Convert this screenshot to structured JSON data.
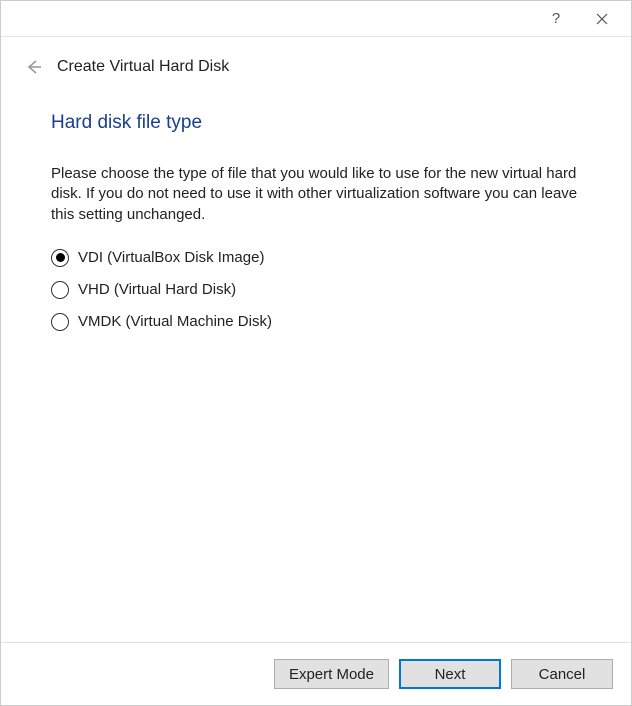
{
  "titlebar": {
    "help": "?",
    "close": "✕"
  },
  "header": {
    "title": "Create Virtual Hard Disk"
  },
  "main": {
    "section_title": "Hard disk file type",
    "description": "Please choose the type of file that you would like to use for the new virtual hard disk. If you do not need to use it with other virtualization software you can leave this setting unchanged.",
    "options": [
      {
        "label": "VDI (VirtualBox Disk Image)",
        "selected": true
      },
      {
        "label": "VHD (Virtual Hard Disk)",
        "selected": false
      },
      {
        "label": "VMDK (Virtual Machine Disk)",
        "selected": false
      }
    ]
  },
  "footer": {
    "expert": "Expert Mode",
    "next": "Next",
    "cancel": "Cancel"
  }
}
